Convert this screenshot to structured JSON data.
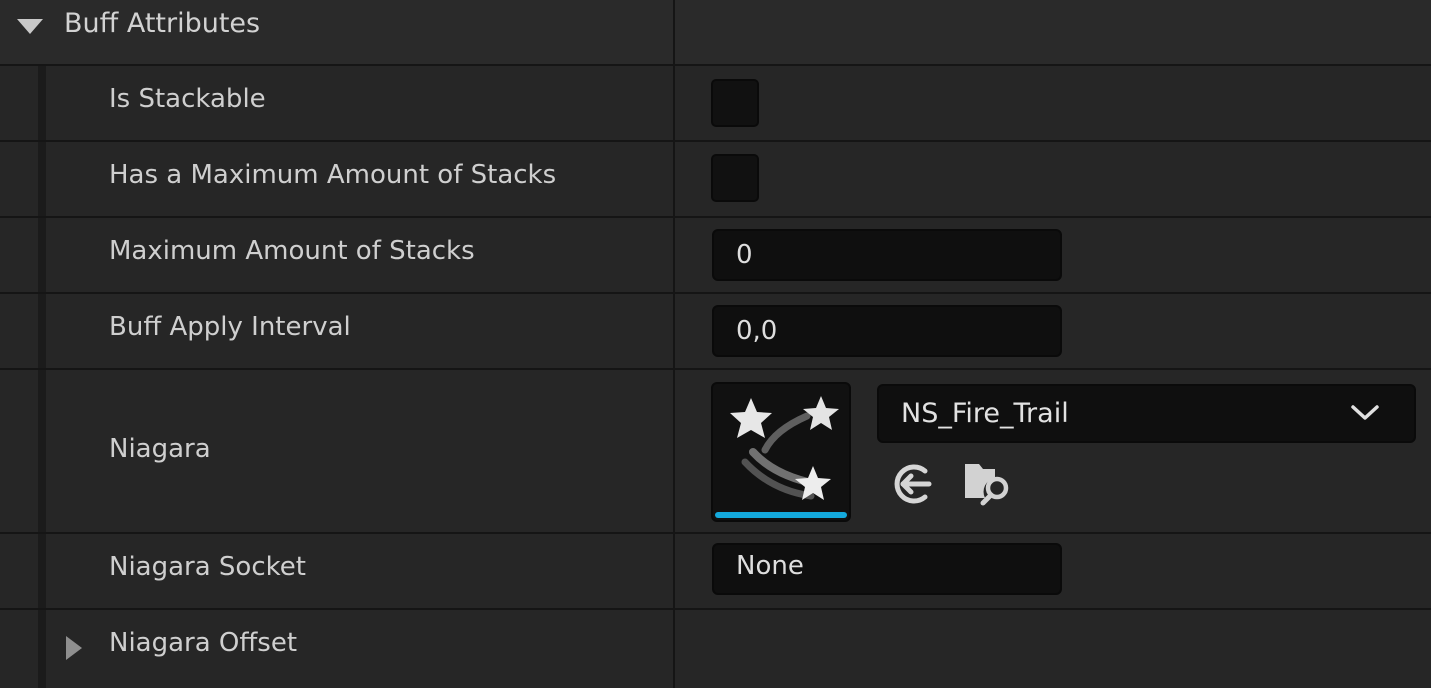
{
  "category": {
    "title": "Buff Attributes"
  },
  "properties": {
    "is_stackable": {
      "label": "Is Stackable"
    },
    "has_max_stacks": {
      "label": "Has a Maximum Amount of Stacks"
    },
    "max_stacks": {
      "label": "Maximum Amount of Stacks",
      "value": "0"
    },
    "apply_interval": {
      "label": "Buff Apply Interval",
      "value": "0,0"
    },
    "niagara": {
      "label": "Niagara",
      "asset_name": "NS_Fire_Trail",
      "thumbnail_icon": "niagara-stars-icon",
      "use_selected_icon": "use-selected-arrow-icon",
      "browse_icon": "browse-folder-magnifier-icon"
    },
    "niagara_socket": {
      "label": "Niagara Socket",
      "value": "None"
    },
    "niagara_offset": {
      "label": "Niagara Offset"
    }
  },
  "colors": {
    "accent": "#14a9dc",
    "background": "#262626",
    "field_bg": "#0f0f0f"
  }
}
